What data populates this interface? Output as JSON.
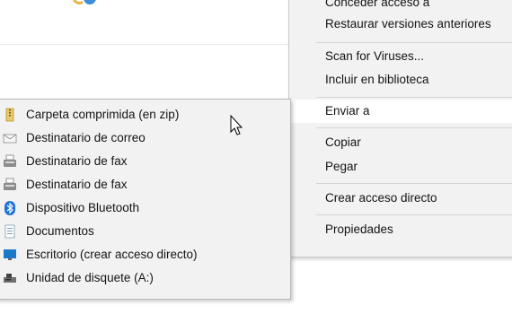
{
  "context_menu": {
    "items": [
      {
        "label": "Conceder acceso a",
        "has_submenu": true
      },
      {
        "label": "Restaurar versiones anteriores"
      },
      {
        "label": "Scan for Viruses..."
      },
      {
        "label": "Incluir en biblioteca",
        "has_submenu": true
      },
      {
        "label": "Enviar a",
        "has_submenu": true,
        "active": true
      },
      {
        "label": "Copiar"
      },
      {
        "label": "Pegar"
      },
      {
        "label": "Crear acceso directo"
      },
      {
        "label": "Propiedades"
      }
    ]
  },
  "send_to_menu": {
    "items": [
      {
        "label": "Carpeta comprimida (en zip)",
        "icon": "zip-folder-icon"
      },
      {
        "label": "Destinatario de correo",
        "icon": "mail-icon"
      },
      {
        "label": "Destinatario de fax",
        "icon": "fax-icon"
      },
      {
        "label": "Destinatario de fax",
        "icon": "fax-icon"
      },
      {
        "label": "Dispositivo Bluetooth",
        "icon": "bluetooth-icon"
      },
      {
        "label": "Documentos",
        "icon": "documents-icon"
      },
      {
        "label": "Escritorio (crear acceso directo)",
        "icon": "desktop-icon"
      },
      {
        "label": "Unidad de disquete (A:)",
        "icon": "floppy-drive-icon"
      }
    ]
  },
  "colors": {
    "menu_bg": "#f2f2f2",
    "hover_bg": "#ffffff",
    "separator": "#d3d3d3",
    "bluetooth": "#1f73d6"
  }
}
